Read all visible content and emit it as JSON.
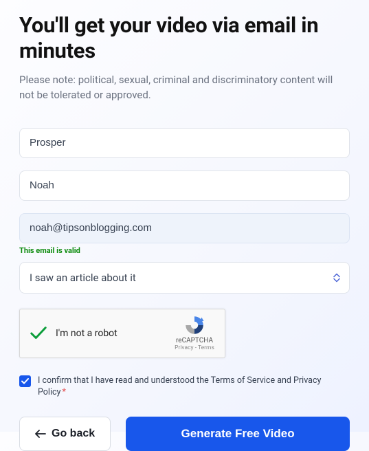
{
  "title": "You'll get your video via email in minutes",
  "subtitle": "Please note: political, sexual, criminal and discriminatory content will not be tolerated or approved.",
  "form": {
    "first_name": "Prosper",
    "last_name": "Noah",
    "email": "noah@tipsonblogging.com",
    "email_valid_msg": "This email is valid",
    "source_selected": "I saw an article about it"
  },
  "recaptcha": {
    "label": "I'm not a robot",
    "brand": "reCAPTCHA",
    "links": "Privacy - Terms"
  },
  "consent": {
    "text_prefix": "I confirm that I have read and understood the ",
    "tos": "Terms of Service",
    "and": " and ",
    "pp": "Privacy Policy",
    "checked": true
  },
  "buttons": {
    "back": "Go back",
    "generate": "Generate Free Video"
  }
}
